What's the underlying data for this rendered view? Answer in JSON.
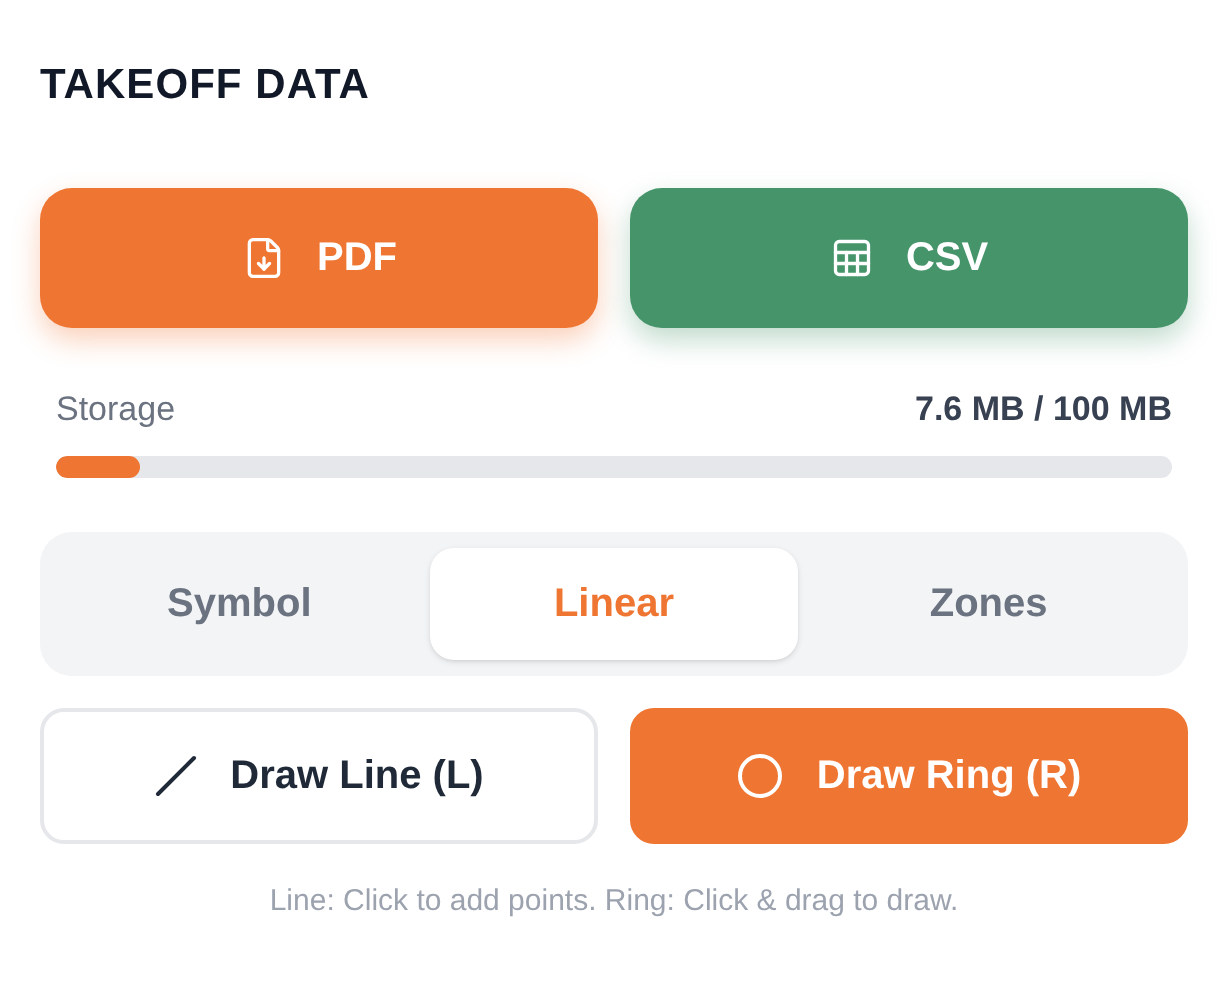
{
  "title": "TAKEOFF DATA",
  "export_buttons": [
    {
      "label": "PDF",
      "kind": "pdf",
      "color": "#ef7632"
    },
    {
      "label": "CSV",
      "kind": "csv",
      "color": "#45946a"
    }
  ],
  "storage": {
    "label": "Storage",
    "reading": "7.6 MB / 100 MB",
    "level": 0.076
  },
  "tabs": [
    {
      "label": "Symbol",
      "selected": false
    },
    {
      "label": "Linear",
      "selected": true
    },
    {
      "label": "Zones",
      "selected": false
    }
  ],
  "tools": [
    {
      "label": "Draw Line (L)",
      "kind": "line",
      "selected": false
    },
    {
      "label": "Draw Ring (R)",
      "kind": "ring",
      "selected": true
    }
  ],
  "hint": "Line: Click to add points. Ring: Click & drag to draw."
}
